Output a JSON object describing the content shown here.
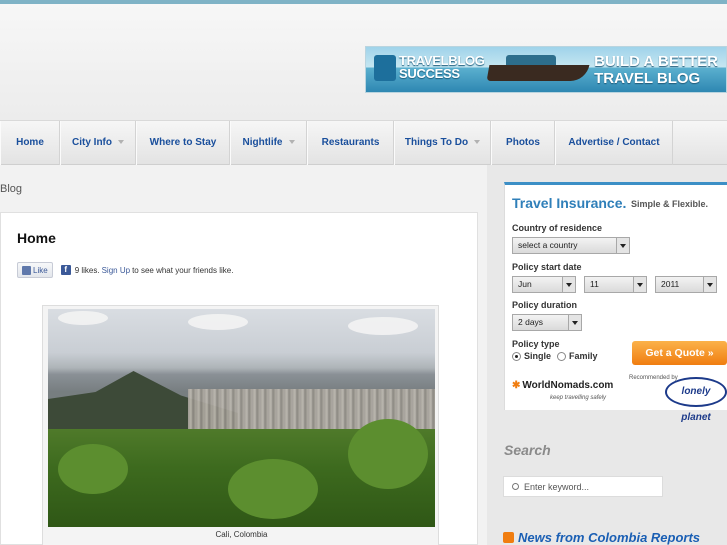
{
  "banner": {
    "brand_line1": "TRAVELBLOG",
    "brand_line2": "SUCCESS",
    "tagline_line1": "BUILD A BETTER",
    "tagline_line2": "TRAVEL BLOG"
  },
  "nav": {
    "items": [
      {
        "label": "Home",
        "dropdown": false
      },
      {
        "label": "City Info",
        "dropdown": true
      },
      {
        "label": "Where to Stay",
        "dropdown": false
      },
      {
        "label": "Nightlife",
        "dropdown": true
      },
      {
        "label": "Restaurants",
        "dropdown": false
      },
      {
        "label": "Things To Do",
        "dropdown": true
      },
      {
        "label": "Photos",
        "dropdown": false
      },
      {
        "label": "Advertise / Contact",
        "dropdown": false
      }
    ]
  },
  "breadcrumb": "Blog",
  "main": {
    "title": "Home",
    "like": {
      "button": "Like",
      "count_text": "9 likes.",
      "signup": "Sign Up",
      "suffix": "to see what your friends like."
    },
    "photo_caption": "Cali, Colombia"
  },
  "insurance": {
    "title": "Travel Insurance.",
    "subtitle": "Simple & Flexible.",
    "residence_label": "Country of residence",
    "residence_value": "select a country",
    "start_label": "Policy start date",
    "start_month": "Jun",
    "start_day": "11",
    "start_year": "2011",
    "duration_label": "Policy duration",
    "duration_value": "2 days",
    "type_label": "Policy type",
    "type_single": "Single",
    "type_family": "Family",
    "type_selected": "Single",
    "quote_button": "Get a Quote »",
    "wn_brand": "WorldNomads.com",
    "wn_tagline": "keep travelling safely",
    "recommended": "Recommended by",
    "lp_brand": "lonely planet"
  },
  "search": {
    "title": "Search",
    "placeholder": "Enter keyword..."
  },
  "news": {
    "title": "News from Colombia Reports"
  },
  "colors": {
    "nav_link": "#1a4f9c",
    "insurance_accent": "#3c8fc6",
    "quote_button": "#f07d10"
  }
}
